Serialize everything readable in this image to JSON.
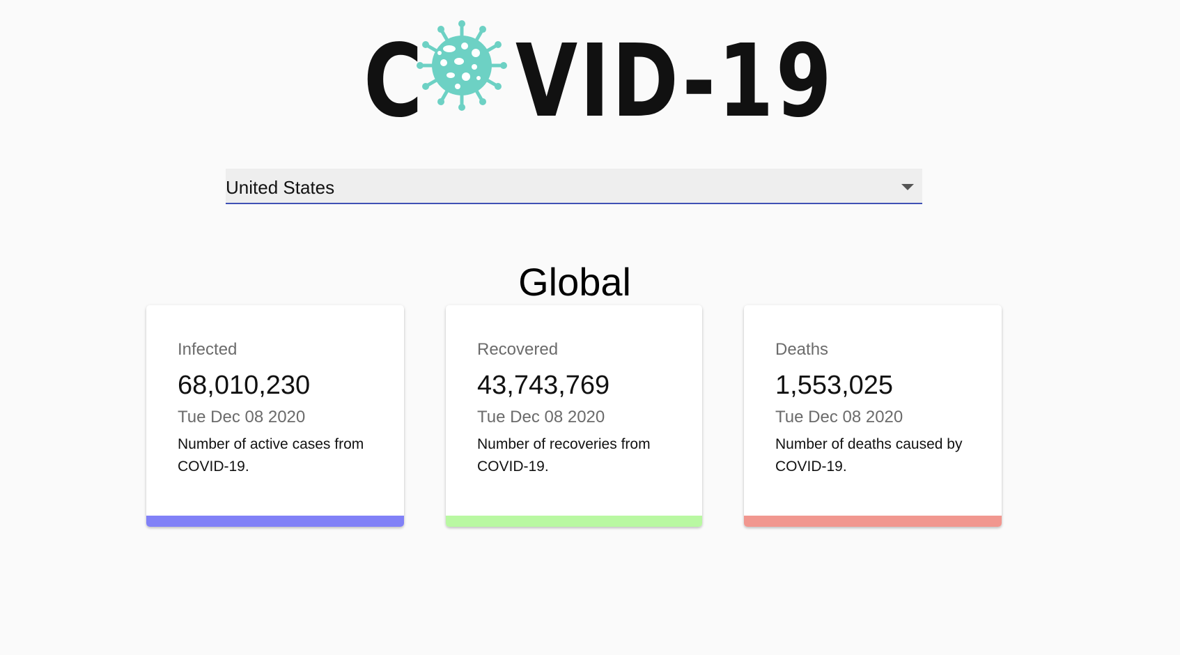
{
  "logo": {
    "text_c": "C",
    "text_rest": "VID-19",
    "virus_color": "#6dd1c4"
  },
  "country_select": {
    "value": "United States",
    "accent_color": "#3f51b5"
  },
  "section_title": "Global",
  "cards": [
    {
      "title": "Infected",
      "value": "68,010,230",
      "date": "Tue Dec 08 2020",
      "description": "Number of active cases from COVID-19.",
      "bar_color": "#8181f7"
    },
    {
      "title": "Recovered",
      "value": "43,743,769",
      "date": "Tue Dec 08 2020",
      "description": "Number of recoveries from COVID-19.",
      "bar_color": "#b9f8a2"
    },
    {
      "title": "Deaths",
      "value": "1,553,025",
      "date": "Tue Dec 08 2020",
      "description": "Number of deaths caused by COVID-19.",
      "bar_color": "#f1978f"
    }
  ]
}
